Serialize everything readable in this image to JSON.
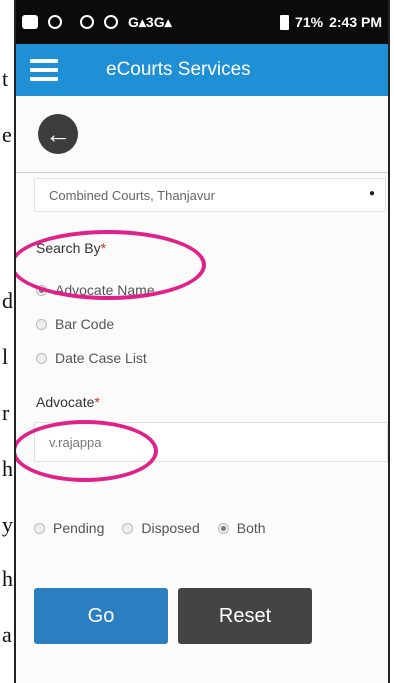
{
  "statusbar": {
    "network": "G▴3G▴",
    "battery": "71%",
    "time": "2:43 PM"
  },
  "appbar": {
    "title": "eCourts Services"
  },
  "court_select": {
    "value": "Combined Courts, Thanjavur"
  },
  "search_by": {
    "label": "Search By",
    "required_mark": "*",
    "options": [
      "Advocate Name",
      "Bar Code",
      "Date Case List"
    ],
    "selected": "Advocate Name"
  },
  "advocate": {
    "label": "Advocate",
    "required_mark": "*",
    "value": "v.rajappa"
  },
  "case_status": {
    "options": [
      "Pending",
      "Disposed",
      "Both"
    ],
    "selected": "Both"
  },
  "buttons": {
    "go": "Go",
    "reset": "Reset"
  },
  "background_letters": [
    "t",
    "e",
    "d",
    "l",
    "r",
    "h",
    "y",
    "h",
    "a"
  ],
  "colors": {
    "appbar": "#1f8fd6",
    "go": "#2b7ec0",
    "reset": "#444444",
    "highlight": "#e0218a"
  }
}
